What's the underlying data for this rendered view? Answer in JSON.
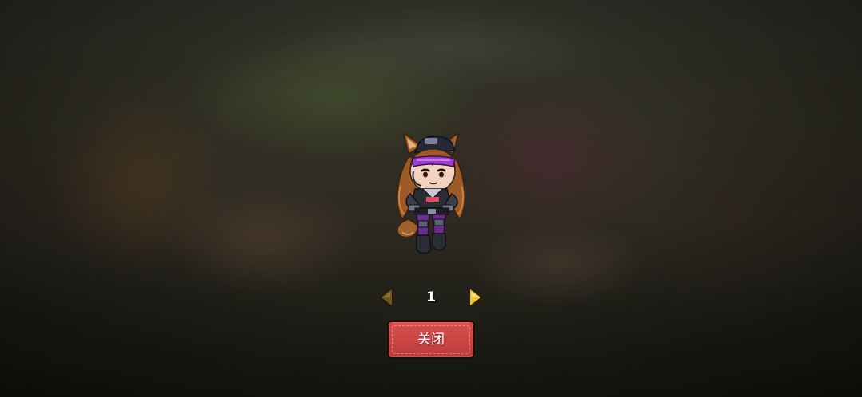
{
  "pager": {
    "current_page": "1",
    "prev_icon": "triangle-left-icon",
    "next_icon": "triangle-right-icon",
    "prev_color": "#6e5a20",
    "next_color": "#f2c431"
  },
  "close_button": {
    "label": "关闭",
    "color": "#cc4646"
  },
  "character": {
    "icon": "chibi-character-portrait"
  }
}
